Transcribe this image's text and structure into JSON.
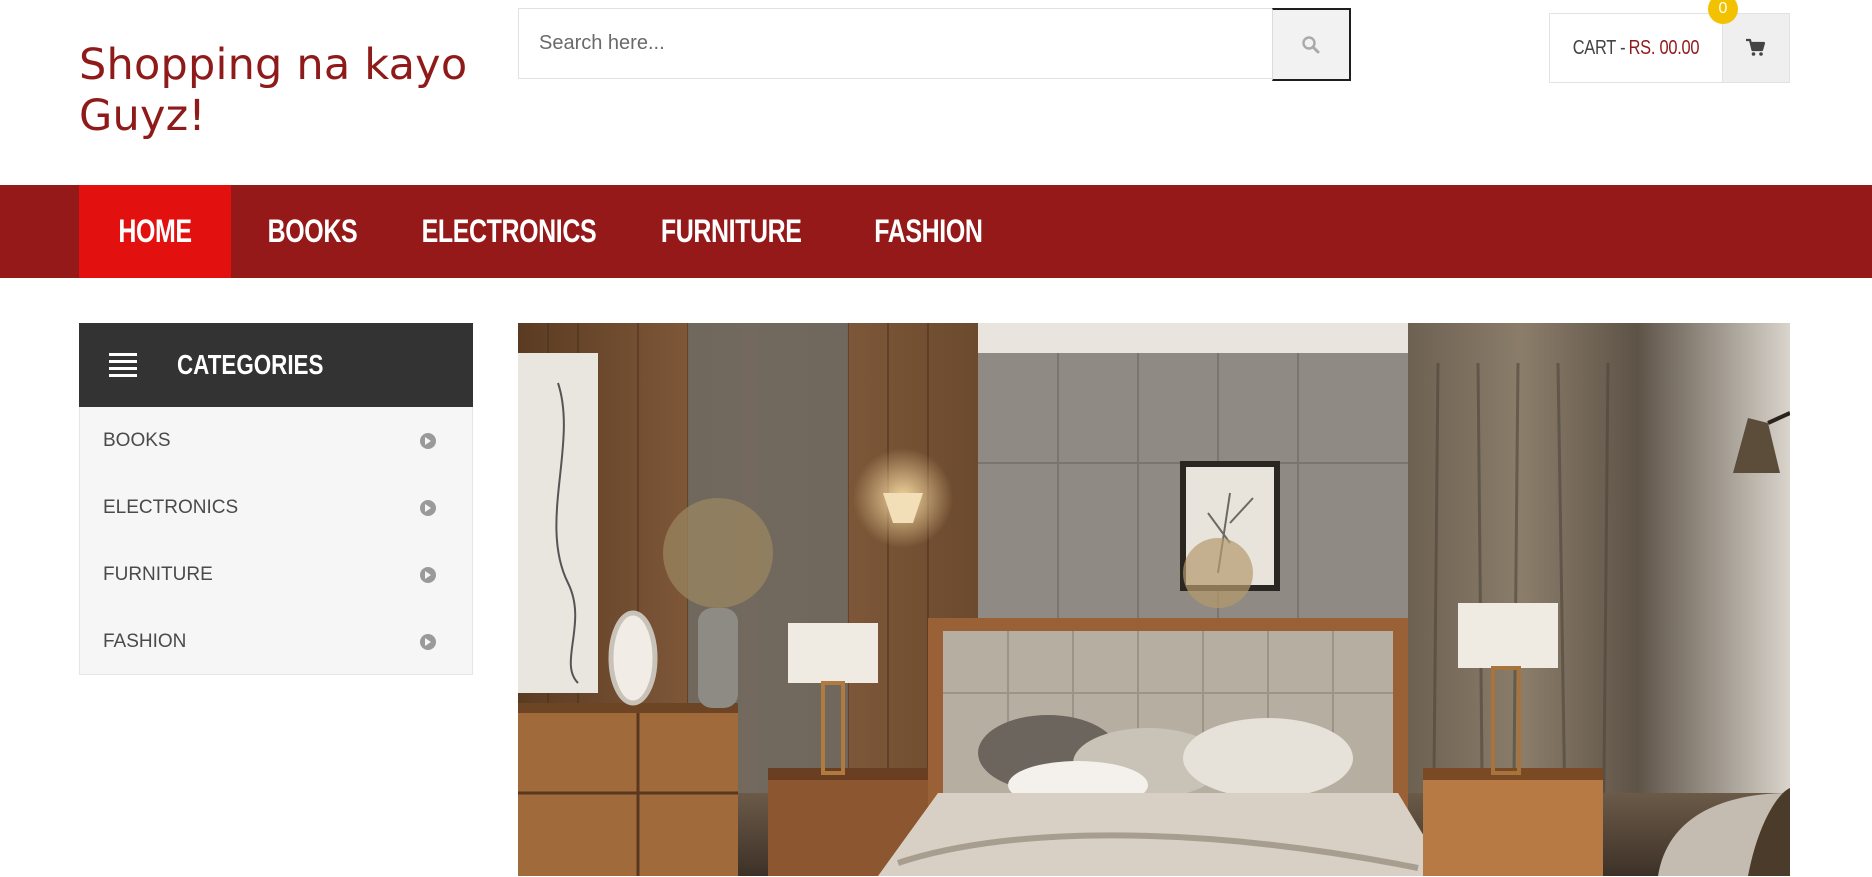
{
  "header": {
    "site_title": "Shopping na kayo Guyz!",
    "search": {
      "placeholder": "Search here...",
      "value": ""
    },
    "cart": {
      "label": "CART - ",
      "amount": "RS. 00.00",
      "count": "0"
    }
  },
  "nav": {
    "items": [
      {
        "label": "HOME",
        "active": true
      },
      {
        "label": "BOOKS"
      },
      {
        "label": "ELECTRONICS"
      },
      {
        "label": "FURNITURE"
      },
      {
        "label": "FASHION"
      }
    ]
  },
  "categories": {
    "title": "CATEGORIES",
    "items": [
      {
        "label": "BOOKS"
      },
      {
        "label": "ELECTRONICS"
      },
      {
        "label": "FURNITURE"
      },
      {
        "label": "FASHION"
      }
    ]
  },
  "hero": {
    "image_icon": "bedroom-photo"
  },
  "colors": {
    "brand": "#961919",
    "nav_active": "#e31010",
    "title": "#8f1a1a",
    "badge": "#f2c200",
    "category_header": "#333333"
  }
}
